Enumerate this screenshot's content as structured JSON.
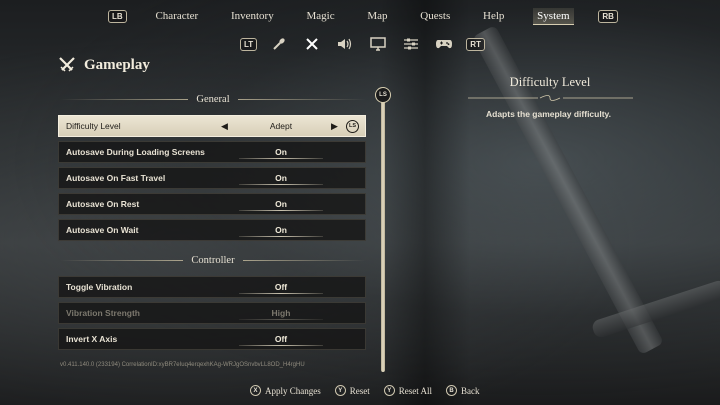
{
  "nav": {
    "left_bumper": "LB",
    "right_bumper": "RB",
    "tabs": [
      {
        "label": "Character"
      },
      {
        "label": "Inventory"
      },
      {
        "label": "Magic"
      },
      {
        "label": "Map"
      },
      {
        "label": "Quests"
      },
      {
        "label": "Help"
      },
      {
        "label": "System",
        "active": true
      }
    ]
  },
  "subnav": {
    "left_trigger": "LT",
    "right_trigger": "RT",
    "icons": [
      "torch-icon",
      "swords-icon",
      "speaker-icon",
      "monitor-icon",
      "sliders-icon",
      "gamepad-icon"
    ],
    "active_icon": "swords-icon"
  },
  "page": {
    "title": "Gameplay",
    "icon": "crossed-swords-icon"
  },
  "sections": {
    "general": "General",
    "controller": "Controller"
  },
  "settings": [
    {
      "label": "Difficulty Level",
      "value": "Adept",
      "selected": true,
      "badge": "LS"
    },
    {
      "label": "Autosave During Loading Screens",
      "value": "On"
    },
    {
      "label": "Autosave On Fast Travel",
      "value": "On"
    },
    {
      "label": "Autosave On Rest",
      "value": "On"
    },
    {
      "label": "Autosave On Wait",
      "value": "On"
    },
    {
      "label": "Toggle Vibration",
      "value": "Off"
    },
    {
      "label": "Vibration Strength",
      "value": "High",
      "disabled": true
    },
    {
      "label": "Invert X Axis",
      "value": "Off"
    }
  ],
  "scrollbar": {
    "badge": "LS"
  },
  "detail": {
    "title": "Difficulty Level",
    "description": "Adapts the gameplay difficulty."
  },
  "version": "v0.411.140.0 (233194) CorrelationID:xyBR7eIuq4erqexhKAg-WRJgOSnvbvLL8OD_H4rgHU",
  "footer": [
    {
      "button": "X",
      "label": "Apply Changes"
    },
    {
      "button": "Y",
      "label": "Reset"
    },
    {
      "button": "Y",
      "label": "Reset All"
    },
    {
      "button": "B",
      "label": "Back"
    }
  ],
  "colors": {
    "accent": "#ece5d3",
    "panel": "#161616",
    "text": "#e6e0d2"
  }
}
